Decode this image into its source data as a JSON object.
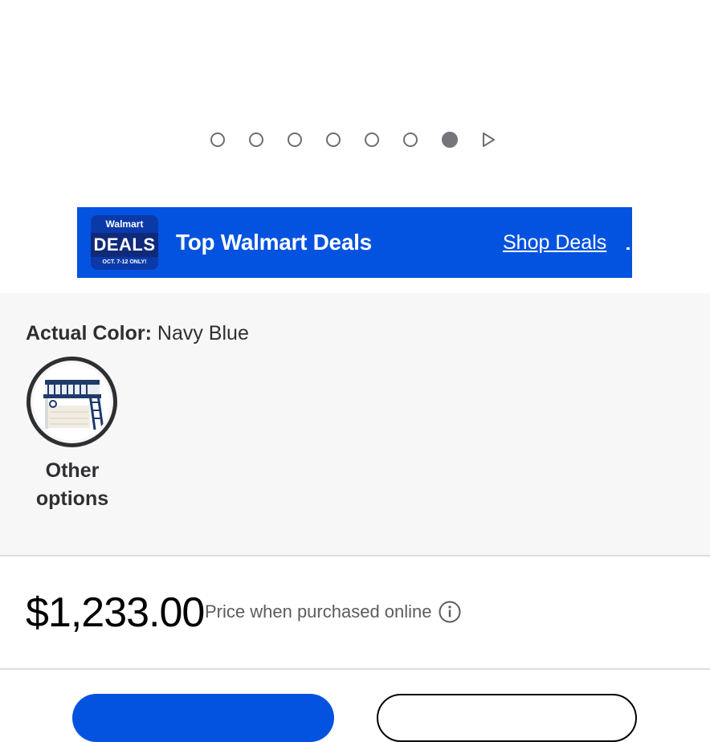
{
  "carousel": {
    "dot_count": 7,
    "active_index": 6,
    "next_icon": "play-triangle-icon"
  },
  "banner": {
    "logo_top": "Walmart",
    "logo_main": "DEALS",
    "logo_sub": "OCT. 7-12 ONLY!",
    "title": "Top Walmart Deals",
    "link": "Shop Deals",
    "bg_color": "#0453e0"
  },
  "variant": {
    "color_label": "Actual Color:",
    "color_value": "Navy Blue",
    "option_label": "Other options"
  },
  "price": {
    "amount": "$1,233.00",
    "note": "Price when purchased online",
    "info_icon": "info-circle-icon"
  },
  "colors": {
    "accent": "#0453e0",
    "section_bg": "#f7f7f7",
    "text": "#2e2f32"
  }
}
